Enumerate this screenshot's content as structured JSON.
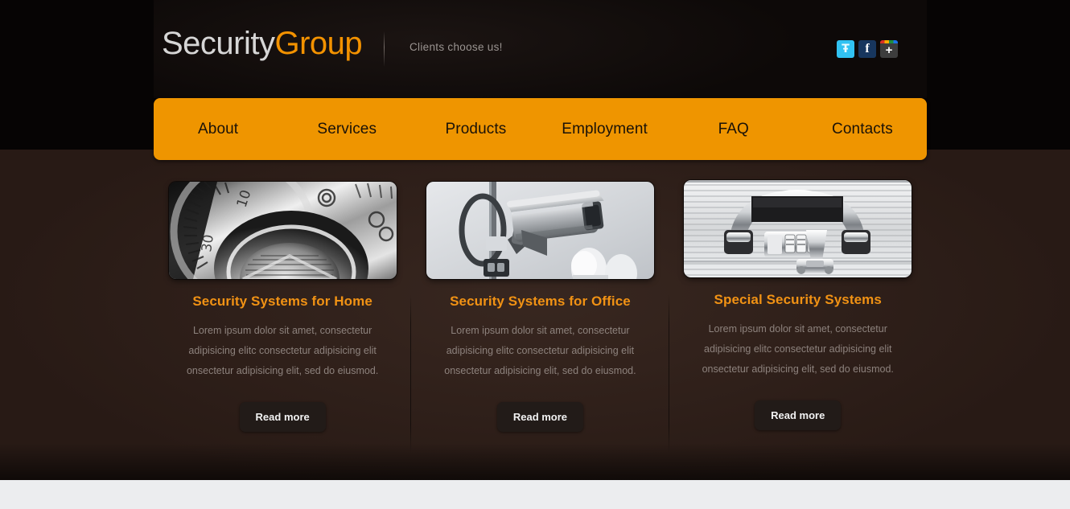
{
  "site": {
    "logo": {
      "primary": "Security",
      "accent": "Group"
    },
    "tagline": "Clients choose us!",
    "colors": {
      "accent_orange": "#ef9500",
      "logo_accent": "#f39200",
      "title_orange": "#f19214",
      "header_black": "#120d0c",
      "body_brown": "#2f211b",
      "bottom_strip": "#ecedef",
      "button_dark": "#221b18",
      "body_text": "#8d827d"
    }
  },
  "social": [
    {
      "name": "twitter",
      "icon": "twitter-icon",
      "glyph": "Ŧ",
      "label": "Twitter",
      "color": "#31c2f2"
    },
    {
      "name": "facebook",
      "icon": "facebook-icon",
      "glyph": "f",
      "label": "Facebook",
      "color": "#17365e"
    },
    {
      "name": "googleplus",
      "icon": "google-plus-icon",
      "glyph": "+",
      "label": "Google Plus",
      "color": "#3d3d3d"
    }
  ],
  "nav": {
    "items": [
      {
        "label": "About"
      },
      {
        "label": "Services"
      },
      {
        "label": "Products"
      },
      {
        "label": "Employment"
      },
      {
        "label": "FAQ"
      },
      {
        "label": "Contacts"
      }
    ]
  },
  "cards": [
    {
      "image_alt": "combination-safe-dial-photo",
      "title": "Security Systems for Home",
      "text": "Lorem ipsum dolor sit amet, consectetur adipisicing elitc consectetur adipisicing elit onsectetur adipisicing elit, sed do eiusmod.",
      "button": "Read more"
    },
    {
      "image_alt": "cctv-security-camera-photo",
      "title": "Security Systems for Office",
      "text": "Lorem ipsum dolor sit amet, consectetur adipisicing elitc consectetur adipisicing elit onsectetur adipisicing elit, sed do eiusmod.",
      "button": "Read more"
    },
    {
      "image_alt": "aluminium-briefcase-combination-lock-photo",
      "title": "Special Security Systems",
      "text": "Lorem ipsum dolor sit amet, consectetur adipisicing elitc consectetur adipisicing elit onsectetur adipisicing elit, sed do eiusmod.",
      "button": "Read more"
    }
  ]
}
